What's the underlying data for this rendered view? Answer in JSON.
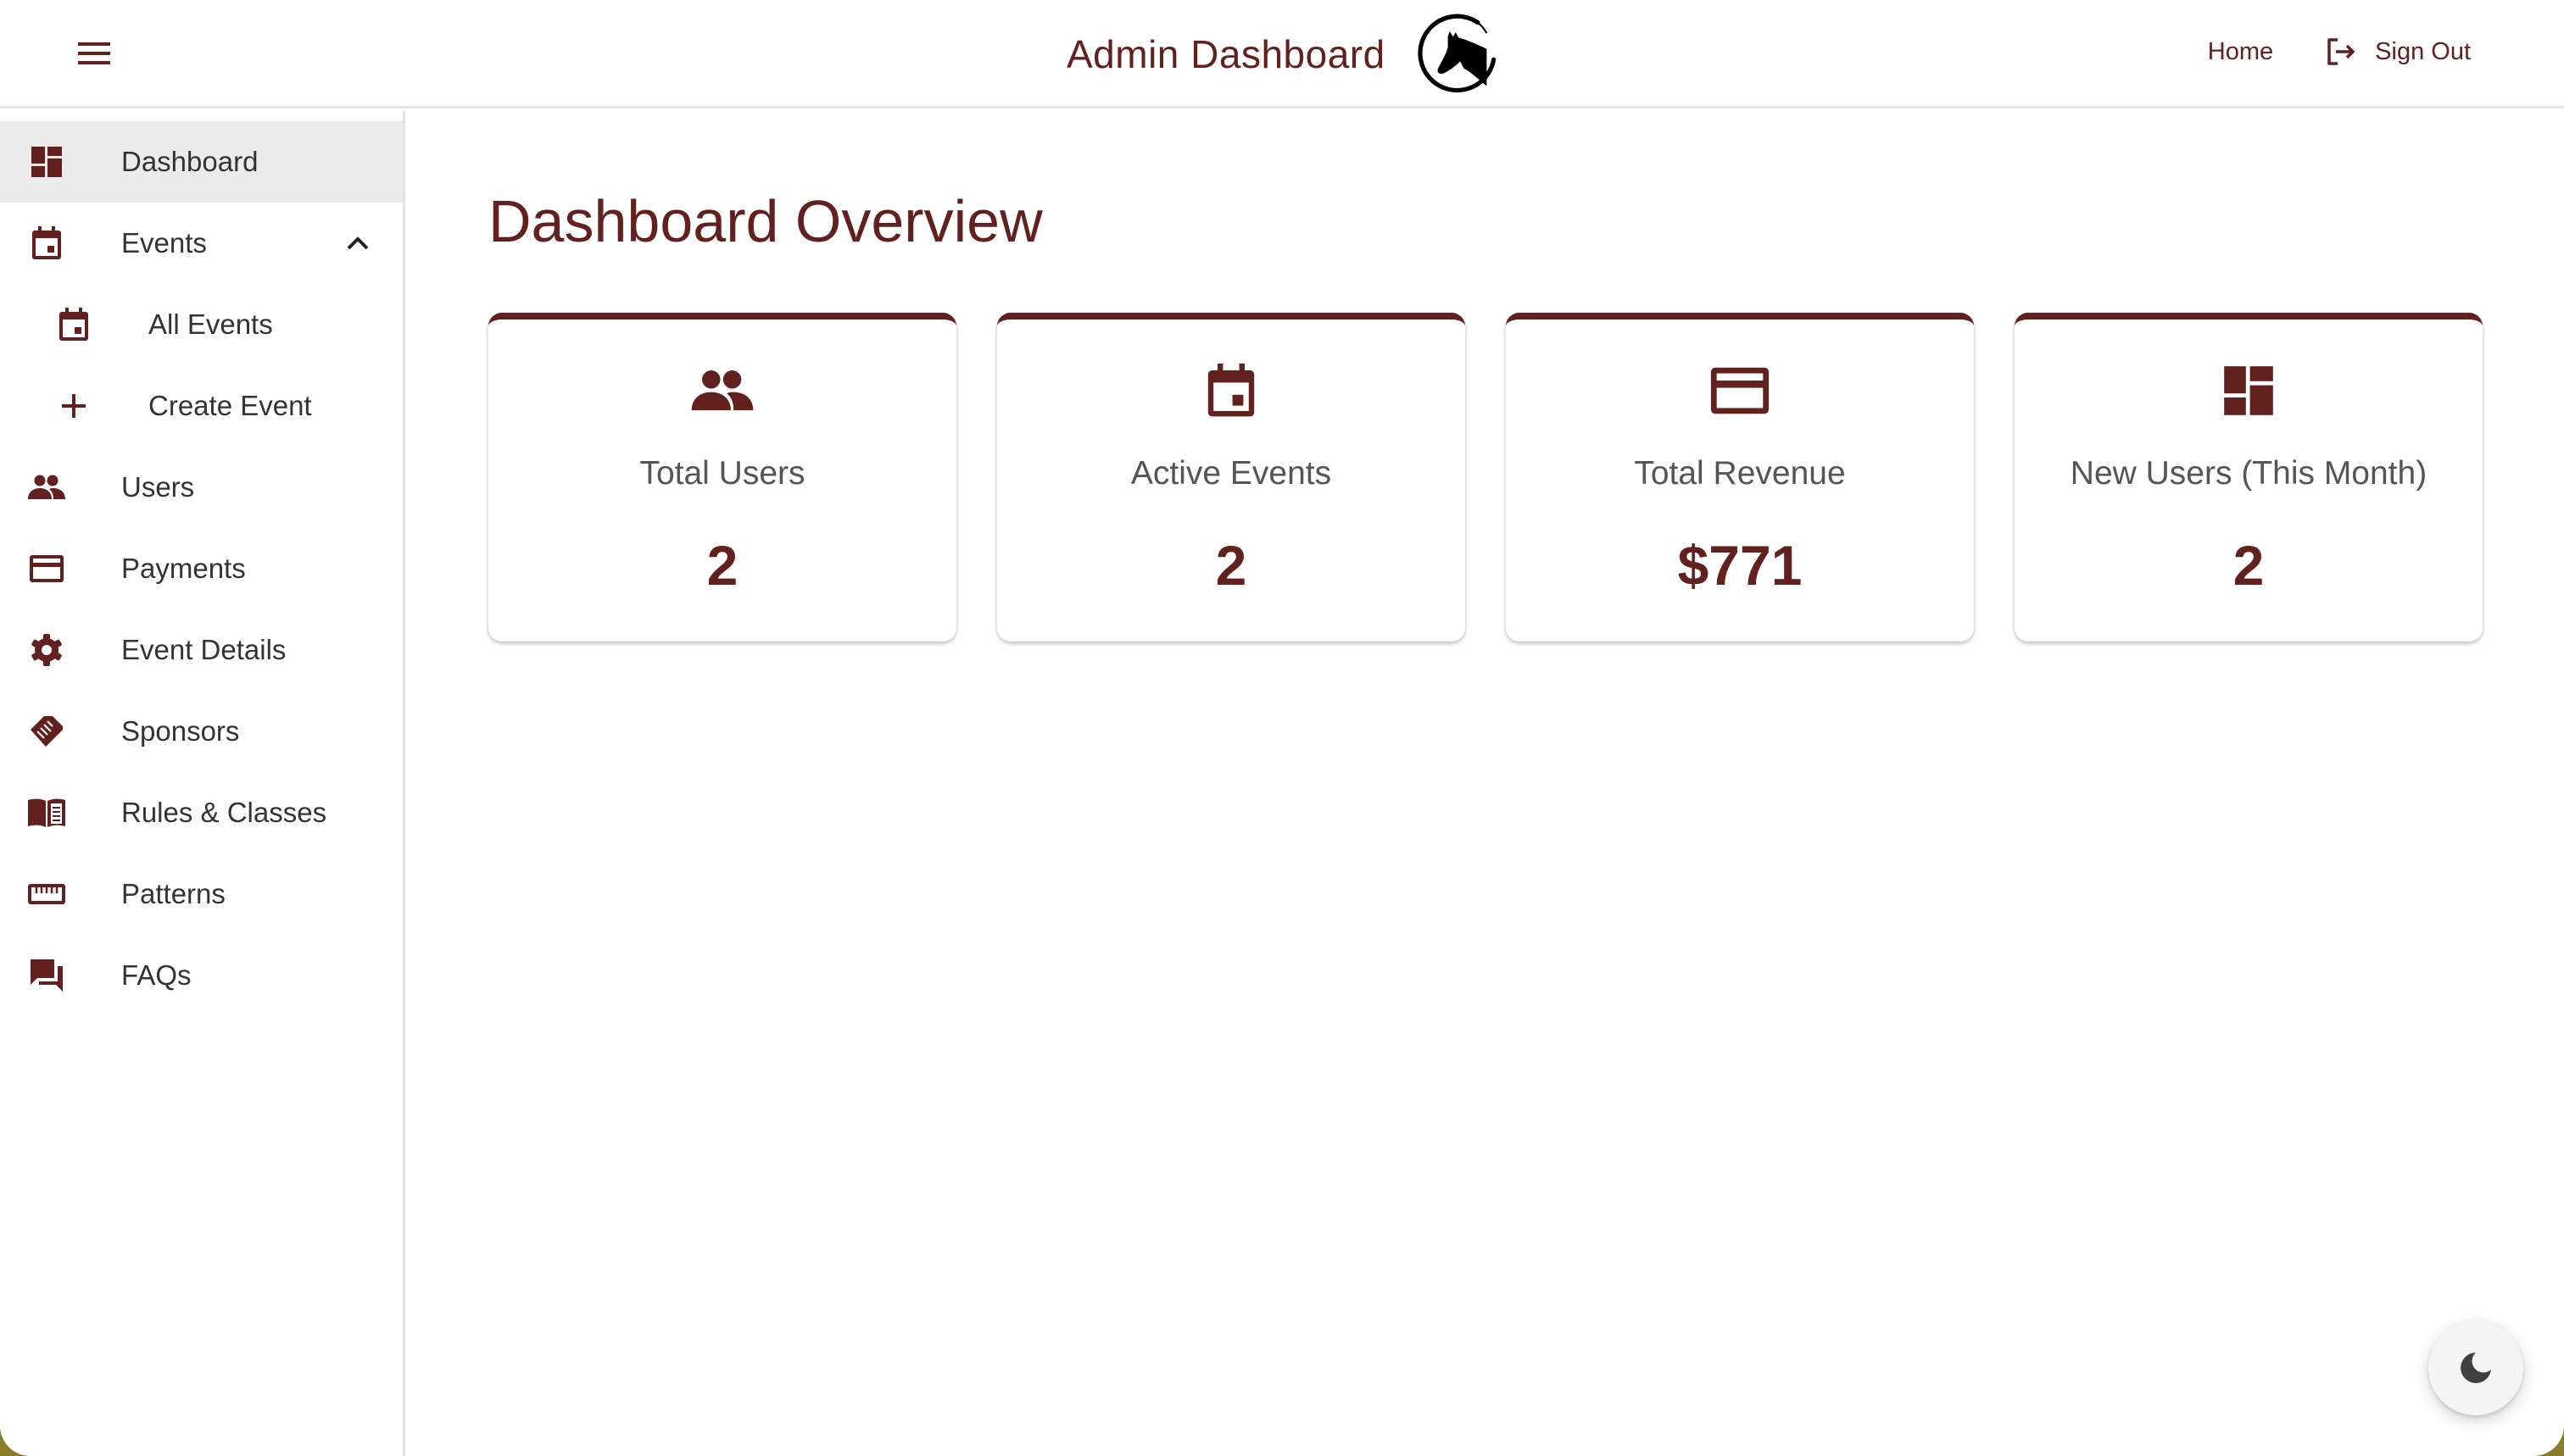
{
  "header": {
    "menu_icon": "hamburger-menu-icon",
    "title": "Admin Dashboard",
    "logo": "horse-head-logo",
    "nav": [
      {
        "label": "Home",
        "icon": null
      },
      {
        "label": "Sign Out",
        "icon": "logout-icon"
      }
    ]
  },
  "sidebar": {
    "items": [
      {
        "label": "Dashboard",
        "icon": "dashboard-icon",
        "active": true,
        "level": 0
      },
      {
        "label": "Events",
        "icon": "calendar-icon",
        "level": 0,
        "expanded": true,
        "expand_icon": "chevron-up-icon"
      },
      {
        "label": "All Events",
        "icon": "calendar-icon",
        "level": 1
      },
      {
        "label": "Create Event",
        "icon": "plus-icon",
        "level": 1
      },
      {
        "label": "Users",
        "icon": "people-icon",
        "level": 0
      },
      {
        "label": "Payments",
        "icon": "credit-card-icon",
        "level": 0
      },
      {
        "label": "Event Details",
        "icon": "gear-icon",
        "level": 0
      },
      {
        "label": "Sponsors",
        "icon": "handshake-icon",
        "level": 0
      },
      {
        "label": "Rules & Classes",
        "icon": "book-icon",
        "level": 0
      },
      {
        "label": "Patterns",
        "icon": "ruler-icon",
        "level": 0
      },
      {
        "label": "FAQs",
        "icon": "forum-icon",
        "level": 0
      }
    ]
  },
  "main": {
    "title": "Dashboard Overview",
    "cards": [
      {
        "label": "Total Users",
        "value": "2",
        "icon": "people-icon"
      },
      {
        "label": "Active Events",
        "value": "2",
        "icon": "calendar-icon"
      },
      {
        "label": "Total Revenue",
        "value": "$771",
        "icon": "credit-card-icon"
      },
      {
        "label": "New Users (This Month)",
        "value": "2",
        "icon": "dashboard-icon"
      }
    ]
  },
  "theme_toggle": {
    "icon": "moon-icon"
  },
  "colors": {
    "accent": "#62201e",
    "text": "#333333",
    "muted_text": "#555555",
    "active_bg": "#ebebeb",
    "border": "#e3e3e3"
  }
}
